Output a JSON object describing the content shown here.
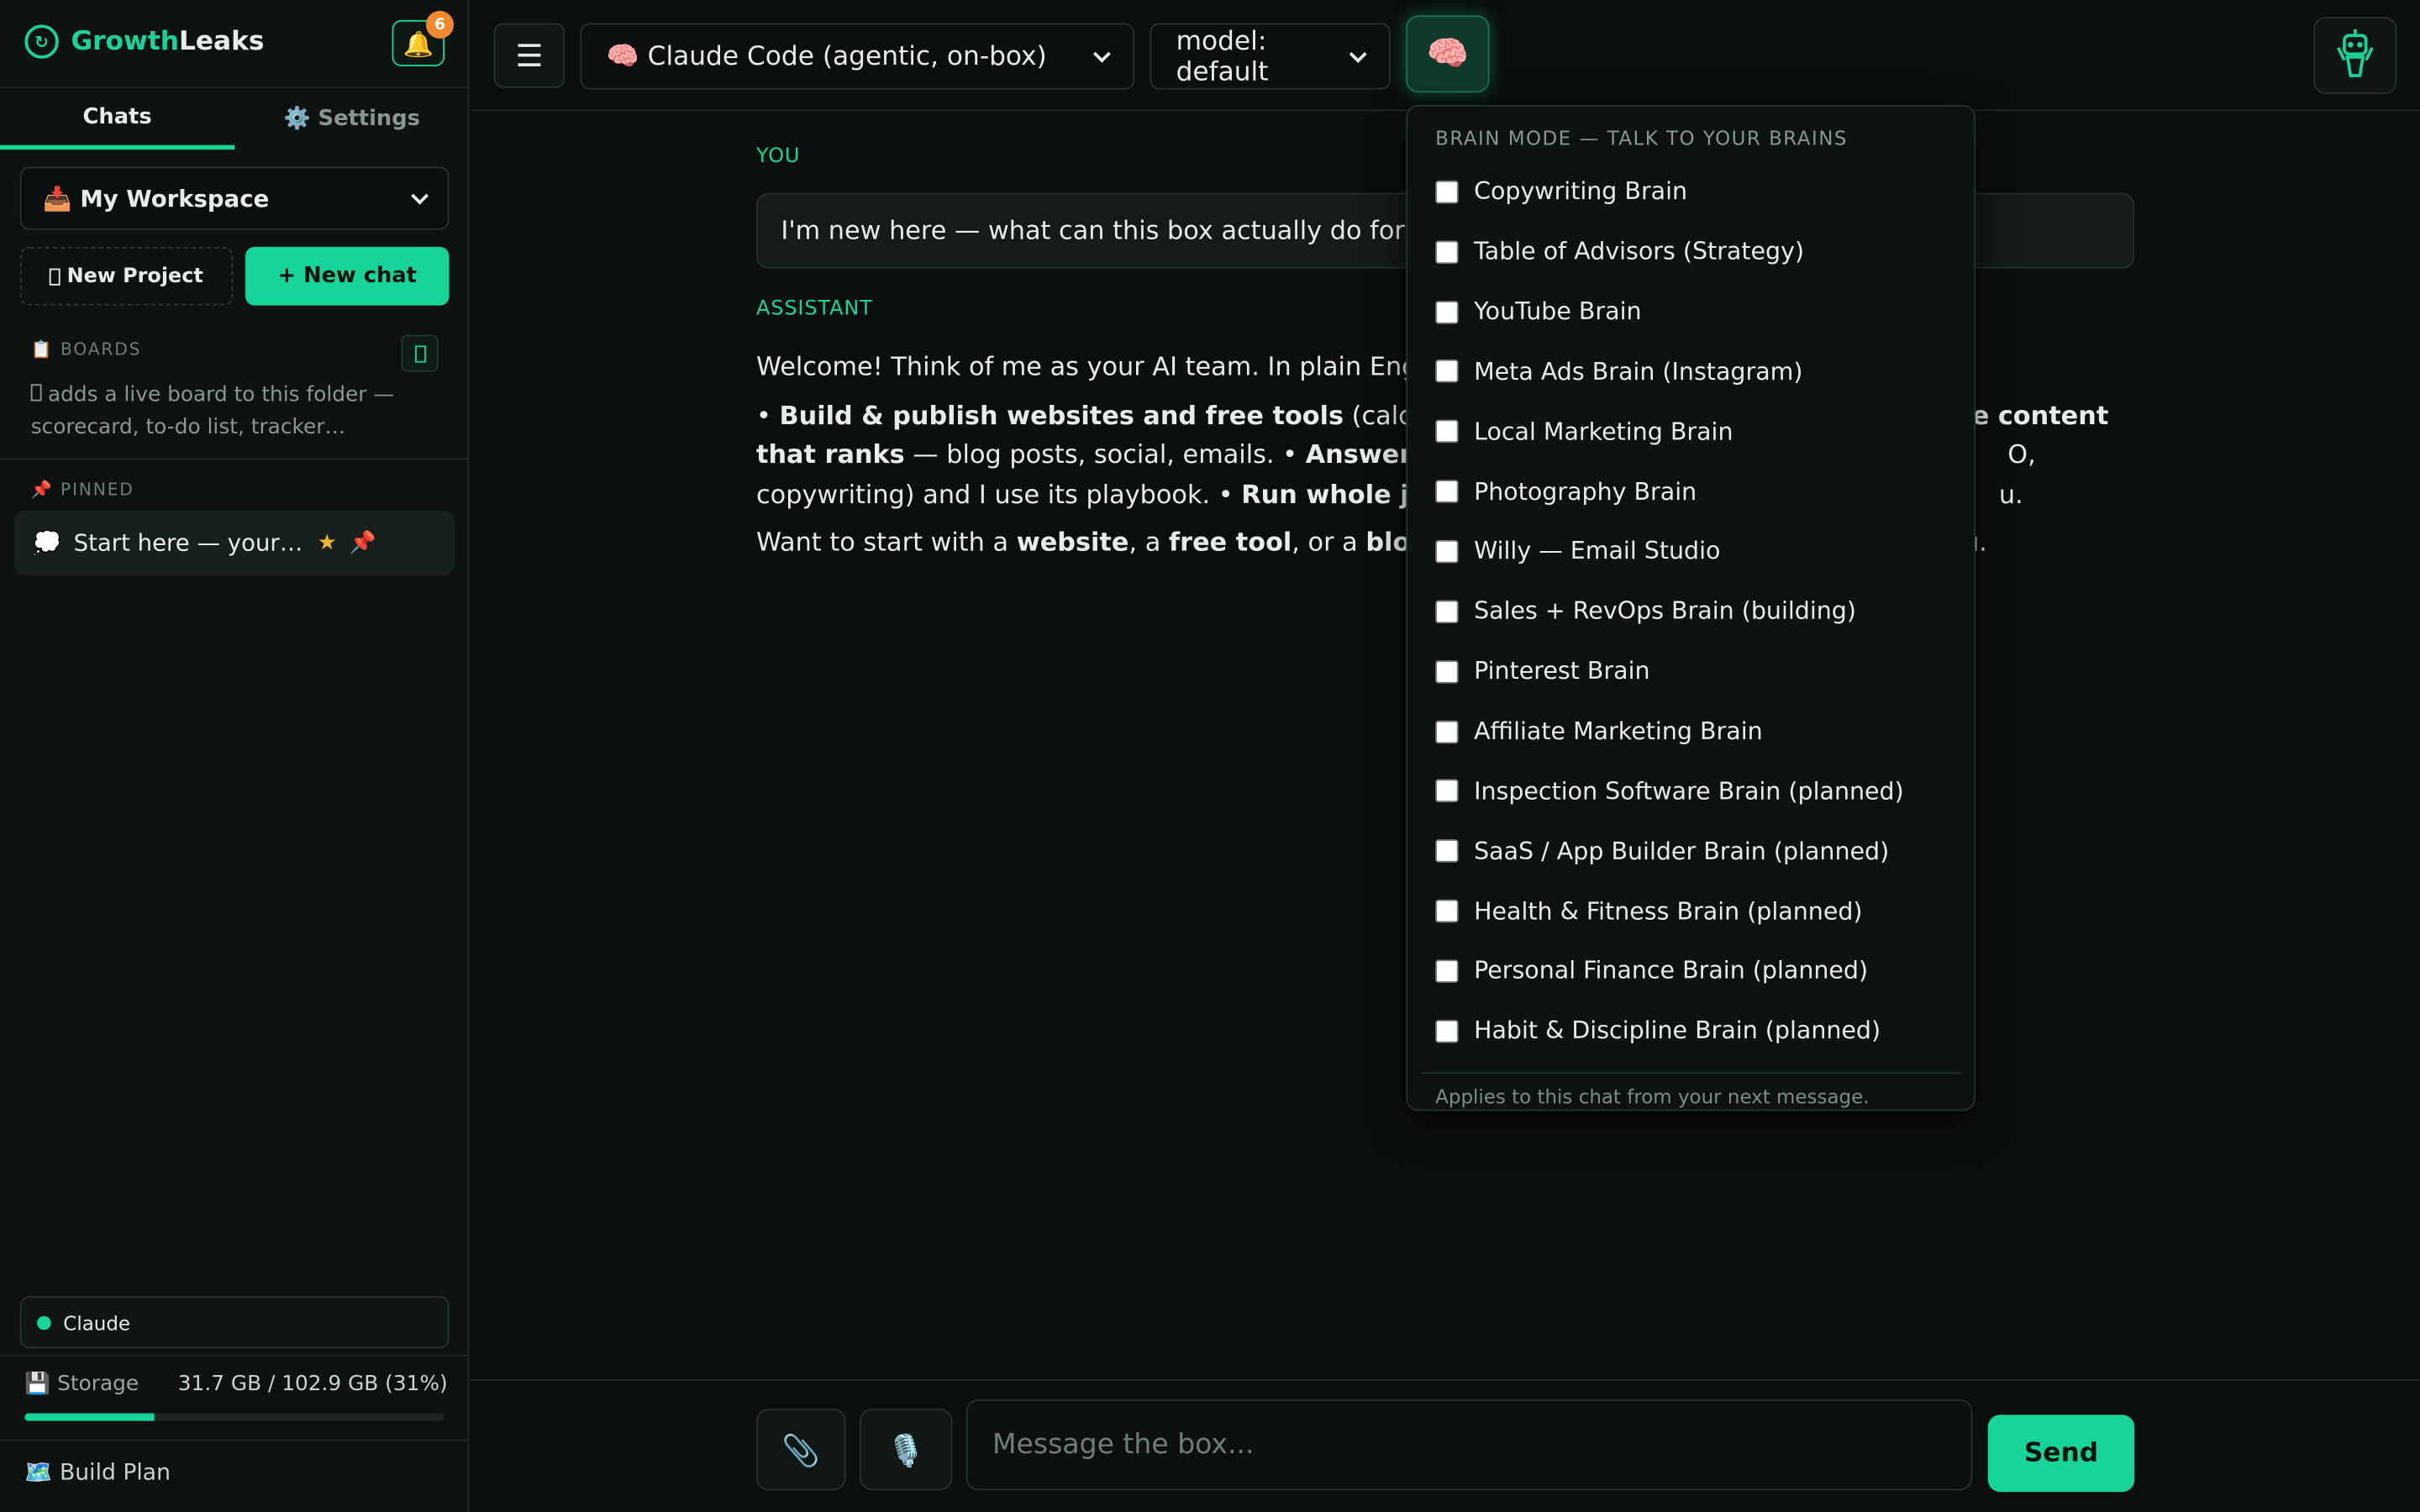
{
  "sidebar": {
    "brand": {
      "part1": "Growth",
      "part2": "Leaks"
    },
    "notification_count": "6",
    "tabs": {
      "chats": "Chats",
      "settings": "⚙️ Settings"
    },
    "workspace": "📥 My Workspace",
    "new_project": "New Project",
    "new_chat": "+ New chat",
    "boards_label": "📋 BOARDS",
    "boards_hint": "adds a live board to this folder — scorecard, to-do list, tracker…",
    "pinned_label": "📌 PINNED",
    "pinned_item": "Start here — your AI team",
    "claude_status": "Claude",
    "storage_label": "💾 Storage",
    "storage_value": "31.7 GB / 102.9 GB (31%)",
    "storage_fraction": 0.31,
    "build_plan": "🗺️ Build Plan"
  },
  "topbar": {
    "engine": "🧠 Claude Code (agentic, on-box)",
    "model": "model: default"
  },
  "chat": {
    "you_label": "YOU",
    "user_message": "I'm new here — what can this box actually do for",
    "assistant_label": "ASSISTANT",
    "p1": "Welcome! Think of me as your AI team. In plain Eng",
    "p2_a": "• ",
    "p2_b": "Build & publish websites and free tools",
    "p2_c": " (calc",
    "p2_d": "ite content",
    "p2_e": "that ranks",
    "p2_f": " — blog posts, social, emails. • ",
    "p2_g": "Answer",
    "p2_h": "O,",
    "p2_i": "copywriting) and I use its playbook. • ",
    "p2_j": "Run whole jo",
    "p2_k": "u.",
    "p3_a": "Want to start with a ",
    "p3_b": "website",
    "p3_c": ", a ",
    "p3_d": "free tool",
    "p3_e": ", or a ",
    "p3_f": "blo",
    "p3_g": "u."
  },
  "composer": {
    "placeholder": "Message the box...",
    "send": "Send"
  },
  "brain_panel": {
    "title": "BRAIN MODE — TALK TO YOUR BRAINS",
    "items": [
      "Copywriting Brain",
      "Table of Advisors (Strategy)",
      "YouTube Brain",
      "Meta Ads Brain (Instagram)",
      "Local Marketing Brain",
      "Photography Brain",
      "Willy — Email Studio",
      "Sales + RevOps Brain (building)",
      "Pinterest Brain",
      "Affiliate Marketing Brain",
      "Inspection Software Brain (planned)",
      "SaaS / App Builder Brain (planned)",
      "Health & Fitness Brain (planned)",
      "Personal Finance Brain (planned)",
      "Habit & Discipline Brain (planned)"
    ],
    "footer": "Applies to this chat from your next message."
  },
  "colors": {
    "accent": "#17d59a",
    "background": "#0b0f0e",
    "badge": "#f08a2e"
  }
}
